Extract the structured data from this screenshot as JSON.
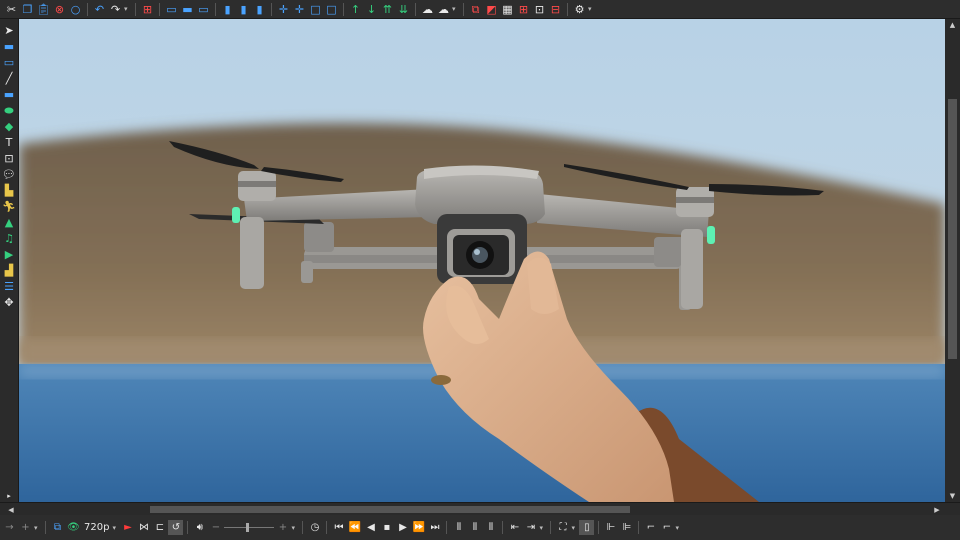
{
  "top_toolbar": {
    "icons": [
      "scissors-icon",
      "copy-icon",
      "paste-icon",
      "delete-icon",
      "circle-icon",
      "undo-icon",
      "redo-icon",
      "select-all-icon",
      "align-left-icon",
      "align-center-icon",
      "align-right-icon",
      "align-top-icon",
      "align-middle-icon",
      "align-bottom-icon",
      "center-horizontal-icon",
      "center-vertical-icon",
      "same-width-icon",
      "same-height-icon",
      "move-up-icon",
      "move-down-icon",
      "bring-front-icon",
      "send-back-icon",
      "group-icon",
      "ungroup-icon",
      "grid-icon",
      "snap-icon",
      "crop-icon",
      "resize-icon",
      "settings-icon"
    ]
  },
  "left_toolbar": {
    "tools": [
      "select-tool",
      "rectangle-tool",
      "note-tool",
      "line-tool",
      "shape-tool",
      "ellipse-tool",
      "polygon-tool",
      "text-tool",
      "caption-tool",
      "callout-tool",
      "chart-tool",
      "actor-tool",
      "image-tool",
      "audio-tool",
      "video-tool",
      "equalizer-tool",
      "animation-tool",
      "move-tool"
    ]
  },
  "bottom_toolbar": {
    "resolution": "720p"
  },
  "colors": {
    "toolbar_bg": "#2d2d2d",
    "accent_blue": "#4aa3ff",
    "accent_green": "#35d07f",
    "record_red": "#ff3b3b"
  }
}
